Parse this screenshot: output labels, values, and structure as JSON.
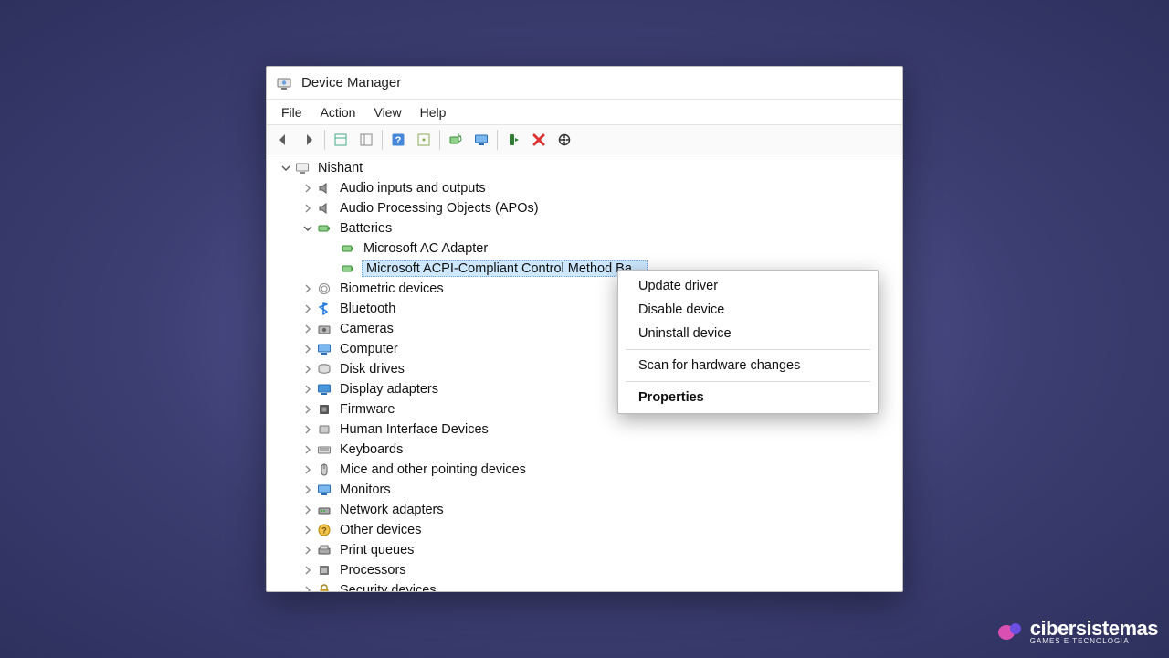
{
  "window": {
    "title": "Device Manager"
  },
  "menu": {
    "file": "File",
    "action": "Action",
    "view": "View",
    "help": "Help"
  },
  "toolbar": {
    "icons": [
      "back",
      "forward",
      "sep",
      "properties-pane",
      "details-pane",
      "sep",
      "help",
      "show-hidden",
      "sep",
      "update-driver",
      "disable",
      "uninstall",
      "delete",
      "scan-hardware"
    ]
  },
  "tree": {
    "root": {
      "label": "Nishant",
      "expanded": true
    },
    "nodes": [
      {
        "label": "Audio inputs and outputs",
        "icon": "speaker",
        "expanded": false
      },
      {
        "label": "Audio Processing Objects (APOs)",
        "icon": "speaker",
        "expanded": false
      },
      {
        "label": "Batteries",
        "icon": "battery",
        "expanded": true,
        "children": [
          {
            "label": "Microsoft AC Adapter",
            "icon": "battery"
          },
          {
            "label": "Microsoft ACPI-Compliant Control Method Battery",
            "icon": "battery",
            "selected": true,
            "truncated": "Microsoft ACPI-Compliant Control Method Ba..."
          }
        ]
      },
      {
        "label": "Biometric devices",
        "icon": "fingerprint",
        "expanded": false
      },
      {
        "label": "Bluetooth",
        "icon": "bluetooth",
        "expanded": false
      },
      {
        "label": "Cameras",
        "icon": "camera",
        "expanded": false
      },
      {
        "label": "Computer",
        "icon": "monitor",
        "expanded": false
      },
      {
        "label": "Disk drives",
        "icon": "disk",
        "expanded": false
      },
      {
        "label": "Display adapters",
        "icon": "display",
        "expanded": false
      },
      {
        "label": "Firmware",
        "icon": "chip",
        "expanded": false
      },
      {
        "label": "Human Interface Devices",
        "icon": "hid",
        "expanded": false
      },
      {
        "label": "Keyboards",
        "icon": "keyboard",
        "expanded": false
      },
      {
        "label": "Mice and other pointing devices",
        "icon": "mouse",
        "expanded": false
      },
      {
        "label": "Monitors",
        "icon": "monitor",
        "expanded": false
      },
      {
        "label": "Network adapters",
        "icon": "network",
        "expanded": false
      },
      {
        "label": "Other devices",
        "icon": "unknown",
        "expanded": false
      },
      {
        "label": "Print queues",
        "icon": "printer",
        "expanded": false
      },
      {
        "label": "Processors",
        "icon": "cpu",
        "expanded": false
      },
      {
        "label": "Security devices",
        "icon": "lock",
        "expanded": false
      }
    ]
  },
  "context_menu": {
    "items": [
      {
        "label": "Update driver"
      },
      {
        "label": "Disable device"
      },
      {
        "label": "Uninstall device"
      },
      {
        "sep": true
      },
      {
        "label": "Scan for hardware changes"
      },
      {
        "sep": true
      },
      {
        "label": "Properties",
        "bold": true
      }
    ]
  },
  "watermark": {
    "brand": "cibersistemas",
    "sub": "GAMES E TECNOLOGIA"
  }
}
